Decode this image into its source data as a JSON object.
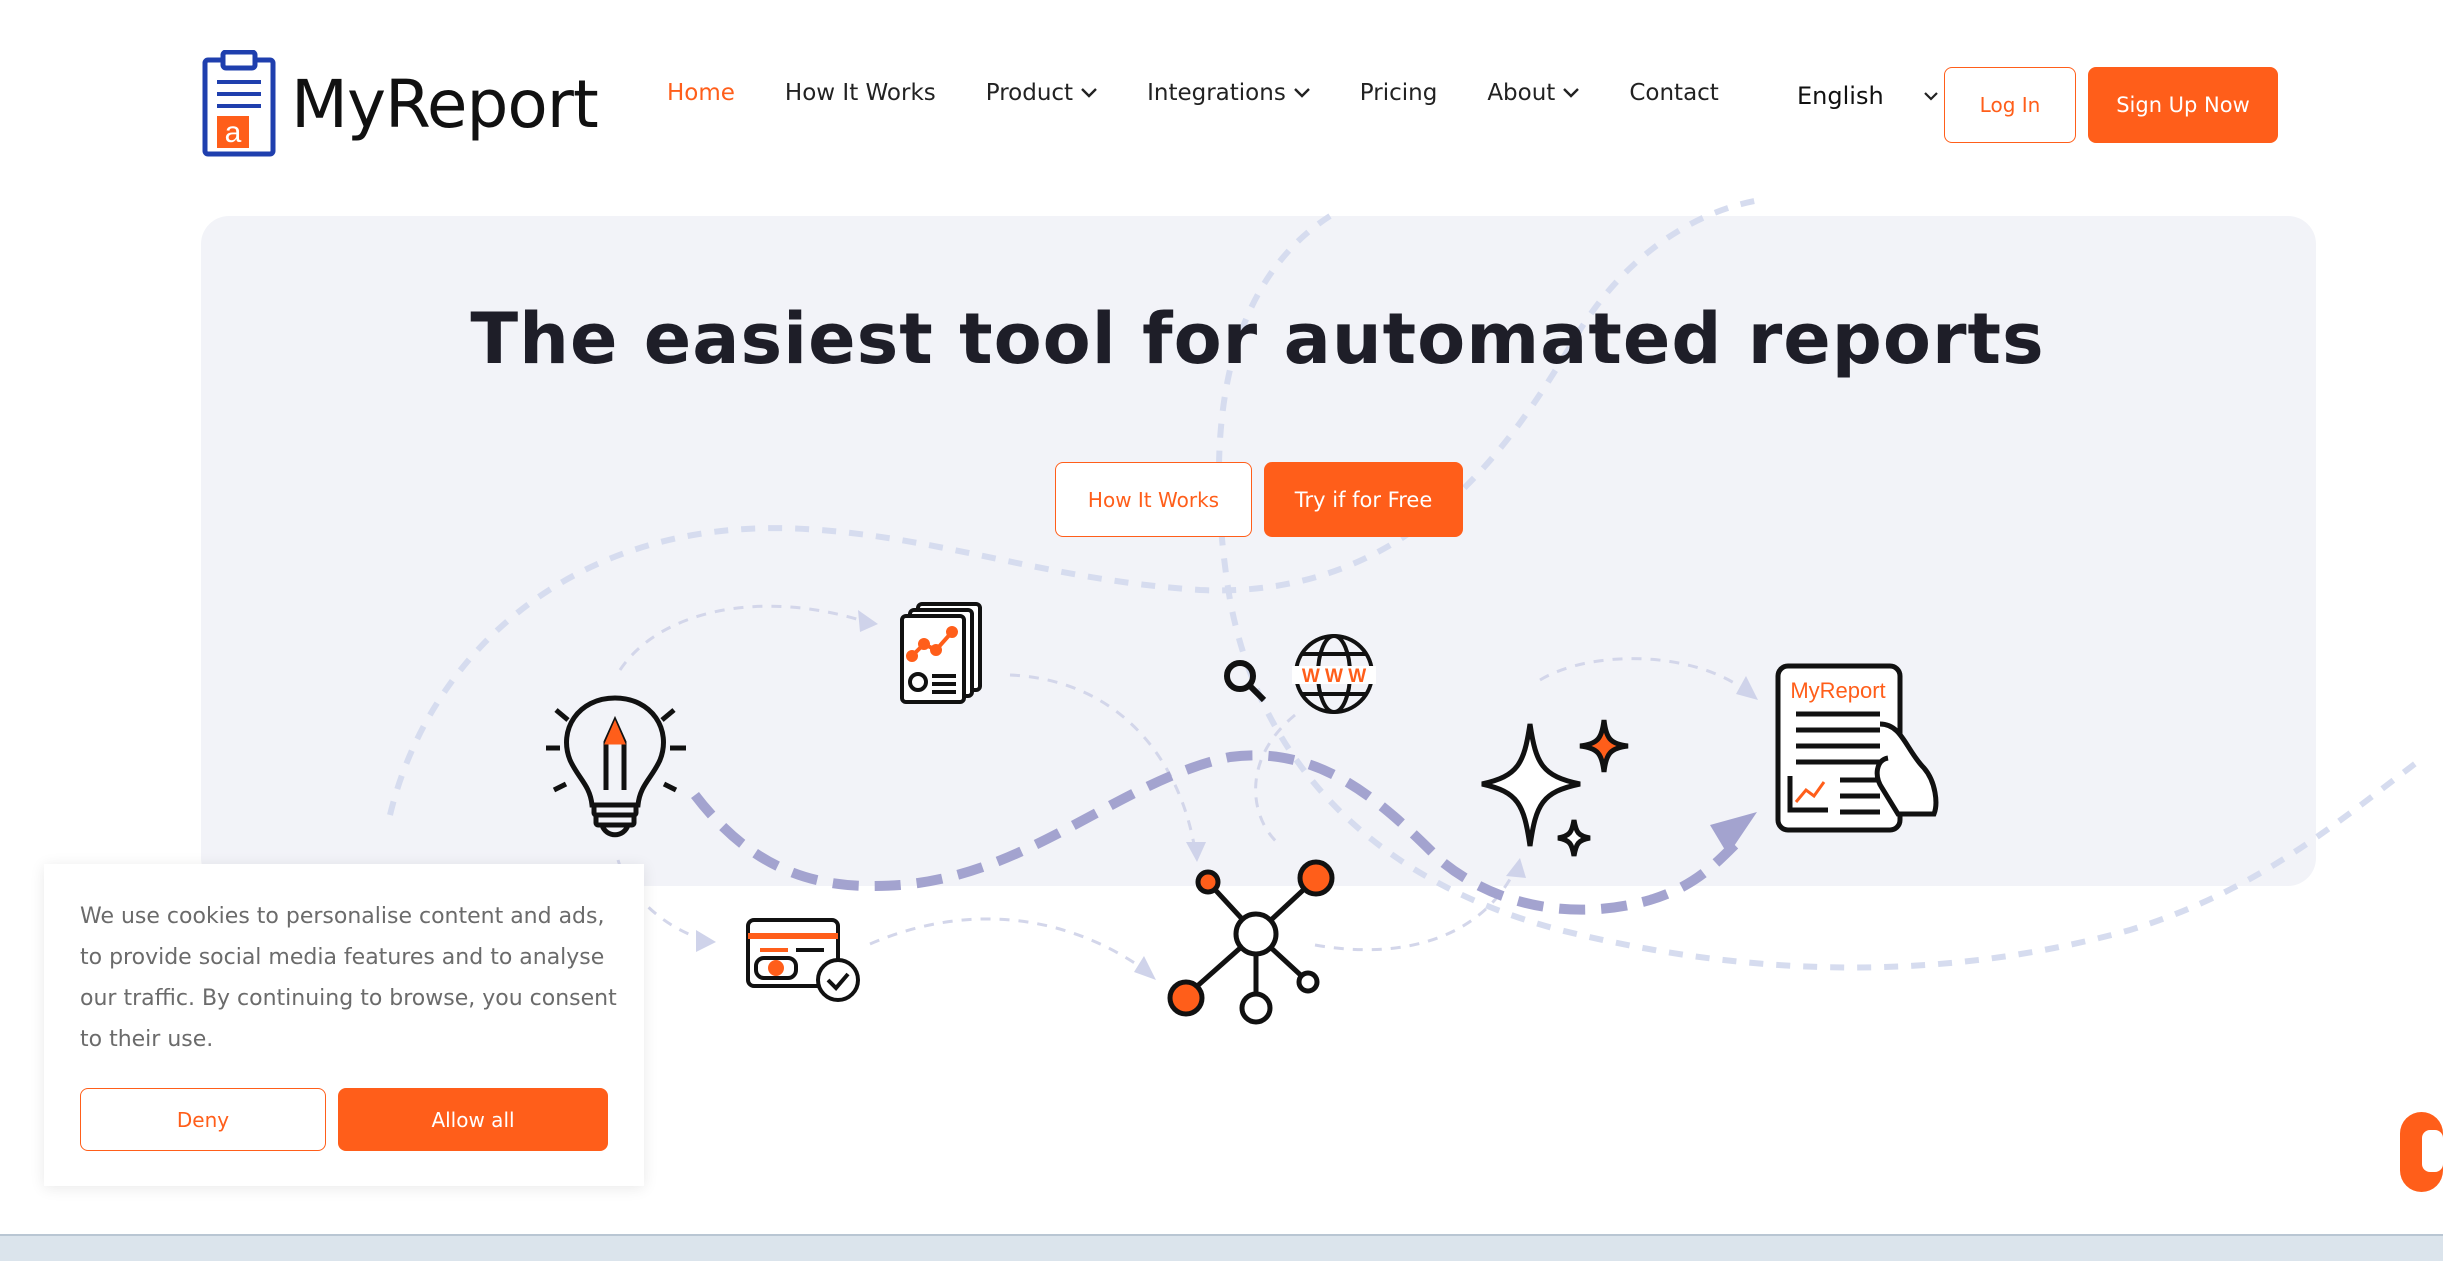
{
  "brand": {
    "name": "MyReport",
    "logo_icon": "clipboard-a-icon"
  },
  "nav": {
    "items": [
      {
        "label": "Home",
        "active": true,
        "dropdown": false
      },
      {
        "label": "How It Works",
        "active": false,
        "dropdown": false
      },
      {
        "label": "Product",
        "active": false,
        "dropdown": true
      },
      {
        "label": "Integrations",
        "active": false,
        "dropdown": true
      },
      {
        "label": "Pricing",
        "active": false,
        "dropdown": false
      },
      {
        "label": "About",
        "active": false,
        "dropdown": true
      },
      {
        "label": "Contact",
        "active": false,
        "dropdown": false
      }
    ],
    "language": "English",
    "login_label": "Log In",
    "signup_label": "Sign Up Now"
  },
  "hero": {
    "title": "The easiest tool for automated reports",
    "how_it_works_label": "How It Works",
    "try_free_label": "Try if for Free",
    "illustration_doc_label": "MyReport",
    "illustration_web_label": "W W W"
  },
  "cookie_banner": {
    "text": "We use cookies to personalise content and ads, to provide social media features and to analyse our traffic. By continuing to browse, you consent to their use.",
    "deny_label": "Deny",
    "allow_label": "Allow all"
  },
  "colors": {
    "accent": "#ff5e1a",
    "hero_bg": "#f2f3f8",
    "path_dark": "#a3a3cf",
    "path_light": "#d6dcef",
    "logo_blue": "#1f3fae"
  }
}
